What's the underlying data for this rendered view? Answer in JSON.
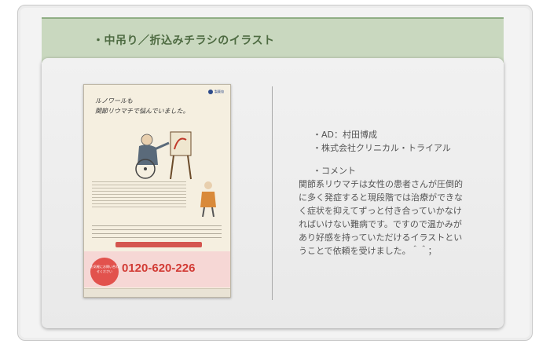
{
  "header": {
    "title": "・中吊り／折込みチラシのイラスト"
  },
  "flyer": {
    "heading": "ルノワールも\n関節リウマチで悩んでいました。",
    "logo_text": "製薬協",
    "badge_text": "お気軽にお問い合わせください",
    "phone": "0120-620-226"
  },
  "info": {
    "ad": "・AD：村田博成",
    "company": "・株式会社クリニカル・トライアル",
    "comment_label": "・コメント",
    "comment_lines": [
      "関節系リウマチは女性の患者さんが圧倒的",
      "に多く発症すると現段階では治療ができな",
      "く症状を抑えてずっと付き合っていかなけ",
      "ればいけない難病です。ですので温かみが",
      "あり好感を持っていただけるイラストとい",
      "うことで依頼を受けました。＾＾；"
    ]
  },
  "colors": {
    "header_band": "#c9d8bf",
    "header_text": "#4e6b42",
    "accent_red": "#d23b35"
  }
}
